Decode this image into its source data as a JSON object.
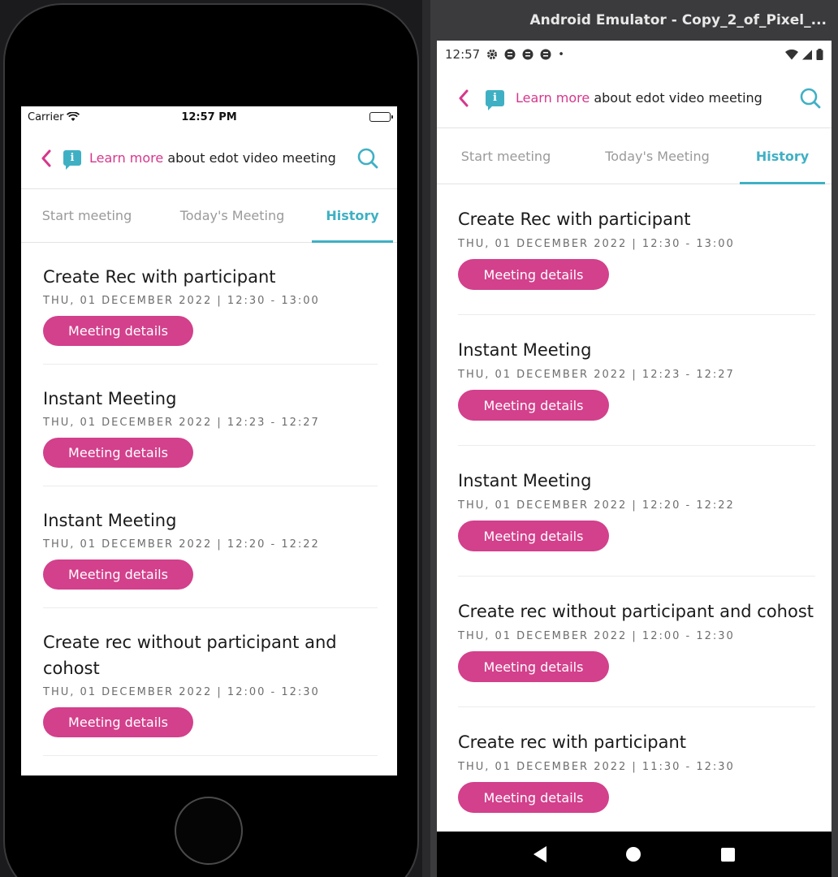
{
  "ios": {
    "status": {
      "carrier": "Carrier",
      "time": "12:57 PM"
    },
    "header": {
      "learn_more": "Learn more",
      "rest": " about edot video meeting"
    },
    "tabs": [
      "Start meeting",
      "Today's Meeting",
      "History"
    ],
    "meetings": [
      {
        "title": "Create Rec with participant",
        "meta": "THU, 01 DECEMBER 2022 | 12:30 - 13:00",
        "button": "Meeting details"
      },
      {
        "title": "Instant Meeting",
        "meta": "THU, 01 DECEMBER 2022 | 12:23 - 12:27",
        "button": "Meeting details"
      },
      {
        "title": "Instant Meeting",
        "meta": "THU, 01 DECEMBER 2022 | 12:20 - 12:22",
        "button": "Meeting details"
      },
      {
        "title": "Create rec without participant and cohost",
        "meta": "THU, 01 DECEMBER 2022 | 12:00 - 12:30",
        "button": "Meeting details"
      }
    ]
  },
  "android": {
    "window_title": "Android Emulator - Copy_2_of_Pixel_...",
    "status": {
      "time": "12:57"
    },
    "header": {
      "learn_more": "Learn more",
      "rest": " about edot video meeting"
    },
    "tabs": [
      "Start meeting",
      "Today's Meeting",
      "History"
    ],
    "meetings": [
      {
        "title": "Create Rec with participant",
        "meta": "THU, 01 DECEMBER 2022 | 12:30 - 13:00",
        "button": "Meeting details"
      },
      {
        "title": "Instant Meeting",
        "meta": "THU, 01 DECEMBER 2022 | 12:23 - 12:27",
        "button": "Meeting details"
      },
      {
        "title": "Instant Meeting",
        "meta": "THU, 01 DECEMBER 2022 | 12:20 - 12:22",
        "button": "Meeting details"
      },
      {
        "title": "Create rec without participant and cohost",
        "meta": "THU, 01 DECEMBER 2022 | 12:00 - 12:30",
        "button": "Meeting details"
      },
      {
        "title": "Create rec with participant",
        "meta": "THU, 01 DECEMBER 2022 | 11:30 - 12:30",
        "button": "Meeting details"
      }
    ]
  },
  "colors": {
    "accent_pink": "#d3408c",
    "accent_teal": "#3fb0c4"
  },
  "icons": [
    "back-chevron-icon",
    "info-chat-icon",
    "search-icon",
    "wifi-icon",
    "battery-icon",
    "gear-icon",
    "signal-icon"
  ]
}
